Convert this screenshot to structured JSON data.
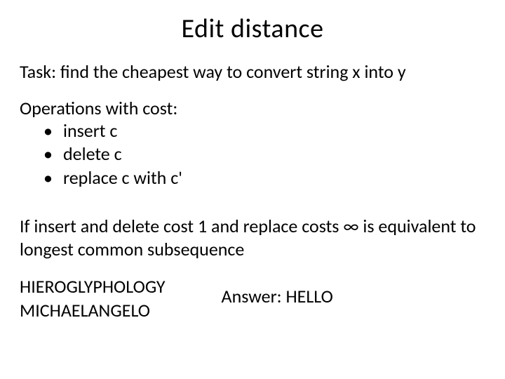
{
  "title": "Edit distance",
  "task": "Task: find the cheapest way to convert string x into y",
  "ops": {
    "heading": "Operations with cost:",
    "items": [
      "insert  c",
      "delete  c",
      "replace  c  with  c'"
    ]
  },
  "equiv": "If insert and delete cost 1 and replace costs ∞ is equivalent to longest common subsequence",
  "words": {
    "a": "HIEROGLYPHOLOGY",
    "b": "MICHAELANGELO"
  },
  "answer": "Answer:   HELLO"
}
